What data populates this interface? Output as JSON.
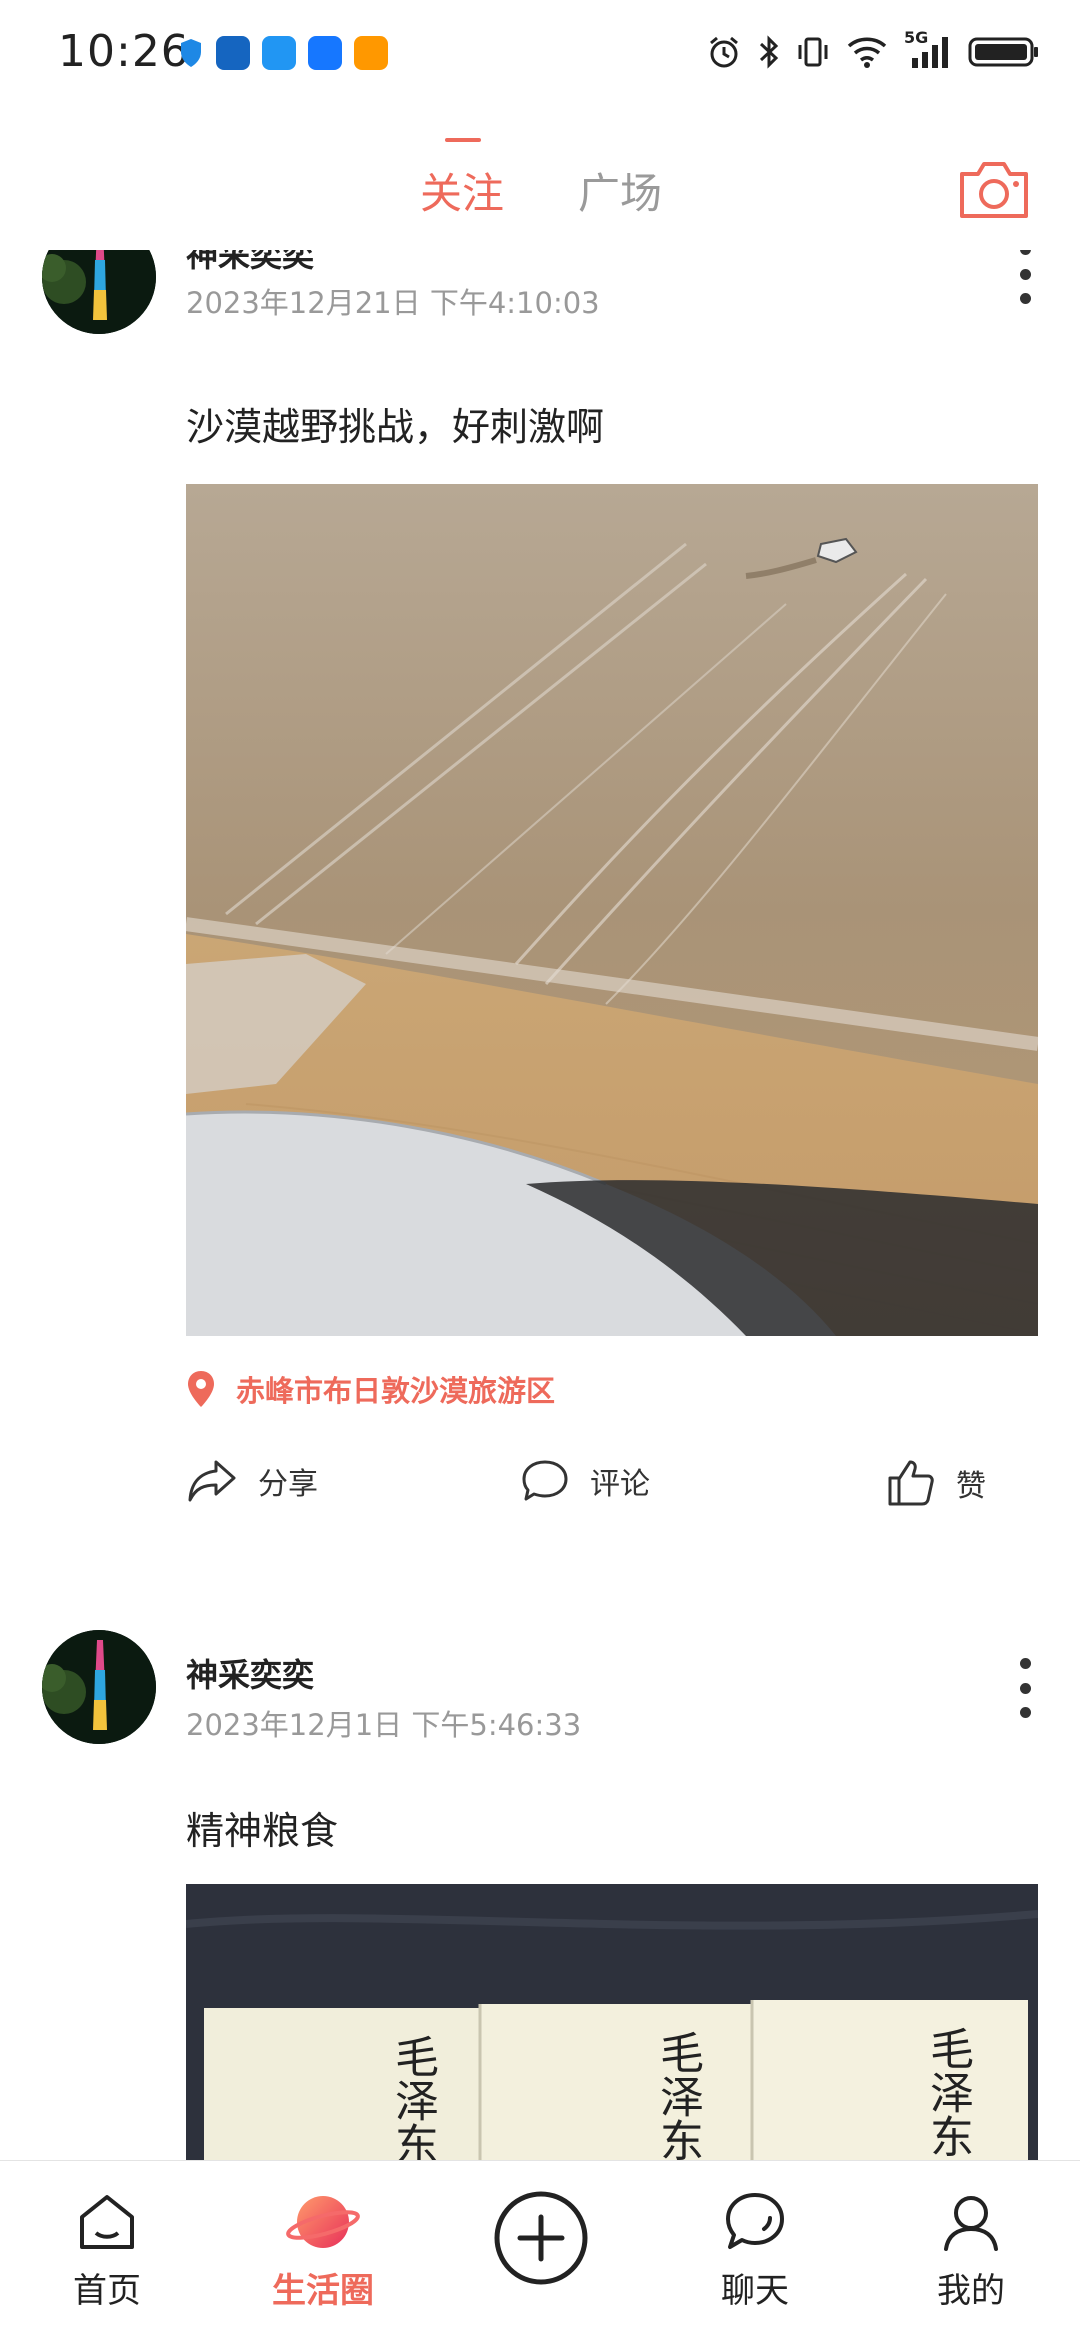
{
  "status_bar": {
    "time": "10:26",
    "network": "5G",
    "icons": [
      "shield-icon",
      "app-icon",
      "chat-app-icon",
      "alipay-icon",
      "app-icon",
      "alarm-icon",
      "bluetooth-icon",
      "vibrate-icon",
      "wifi-icon",
      "signal-icon",
      "battery-icon"
    ]
  },
  "header": {
    "tabs": [
      {
        "label": "关注",
        "active": true
      },
      {
        "label": "广场",
        "active": false
      }
    ],
    "camera_icon": "camera-icon",
    "accent_color": "#ee6a5b"
  },
  "feed": {
    "posts": [
      {
        "author": "神采奕奕",
        "time": "2023年12月21日 下午4:10:03",
        "text": "沙漠越野挑战，好刺激啊",
        "image": "desert-dune-photo",
        "location": "赤峰市布日敦沙漠旅游区",
        "actions": {
          "share": "分享",
          "comment": "评论",
          "like": "赞"
        }
      },
      {
        "author": "神采奕奕",
        "time": "2023年12月1日 下午5:46:33",
        "text": "精神粮食",
        "image": "calligraphy-books-photo",
        "book_title": "毛泽东"
      }
    ]
  },
  "bottom_nav": {
    "items": [
      {
        "label": "首页",
        "icon": "home-icon",
        "active": false
      },
      {
        "label": "生活圈",
        "icon": "planet-icon",
        "active": true
      },
      {
        "label": "",
        "icon": "add-icon",
        "active": false
      },
      {
        "label": "聊天",
        "icon": "chat-icon",
        "active": false
      },
      {
        "label": "我的",
        "icon": "profile-icon",
        "active": false
      }
    ]
  }
}
